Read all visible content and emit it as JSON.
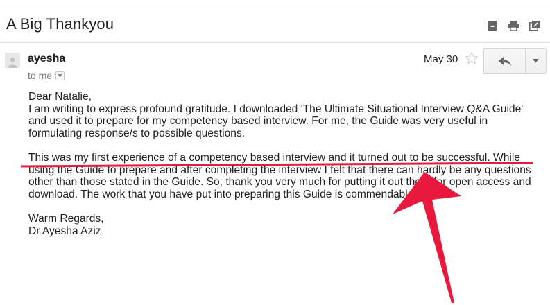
{
  "email": {
    "subject": "A Big Thankyou",
    "sender": "ayesha",
    "recipient": "to me",
    "date": "May 30",
    "greeting": "Dear Natalie,",
    "paragraph1_lines": [
      "I am writing to express profound gratitude. I downloaded 'The Ultimate Situational Interview Q&A Guide'",
      "and used it to prepare for my competency based interview. For me, the Guide was very useful in",
      "formulating response/s to possible questions."
    ],
    "paragraph2_lines": [
      "This was my first experience of a competency based interview and it turned out to be successful. While",
      "using the Guide to prepare and after completing the interview I felt that there can hardly be any questions",
      "other than those stated in the Guide. So, thank you very much for putting it out there for open access and",
      "download. The work that you have put into preparing this Guide is commendable."
    ],
    "closing": "Warm Regards,",
    "signature": "Dr Ayesha Aziz"
  },
  "icons": {
    "header": [
      "archive-icon",
      "print-icon",
      "new-window-icon"
    ],
    "star": "star-icon",
    "reply": "reply-icon",
    "more": "chevron-down-icon"
  },
  "colors": {
    "annotation": "#e8193c",
    "text": "#222222",
    "muted": "#777777"
  }
}
